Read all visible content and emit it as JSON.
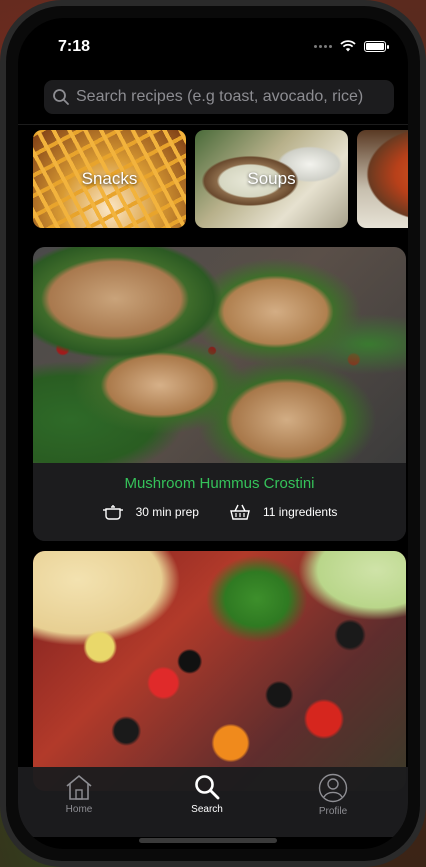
{
  "status_bar": {
    "time": "7:18"
  },
  "search": {
    "placeholder": "Search recipes (e.g toast, avocado, rice)"
  },
  "categories": [
    {
      "label": "Snacks"
    },
    {
      "label": "Soups"
    },
    {
      "label": ""
    }
  ],
  "recipes": [
    {
      "title": "Mushroom Hummus Crostini",
      "prep": "30 min prep",
      "ingredients": "11 ingredients"
    }
  ],
  "tabbar": {
    "home_label": "Home",
    "search_label": "Search",
    "profile_label": "Profile",
    "active_tab": "Search"
  },
  "colors": {
    "accent_green": "#35c25a",
    "background": "#000000",
    "card": "#1c1c1e"
  }
}
